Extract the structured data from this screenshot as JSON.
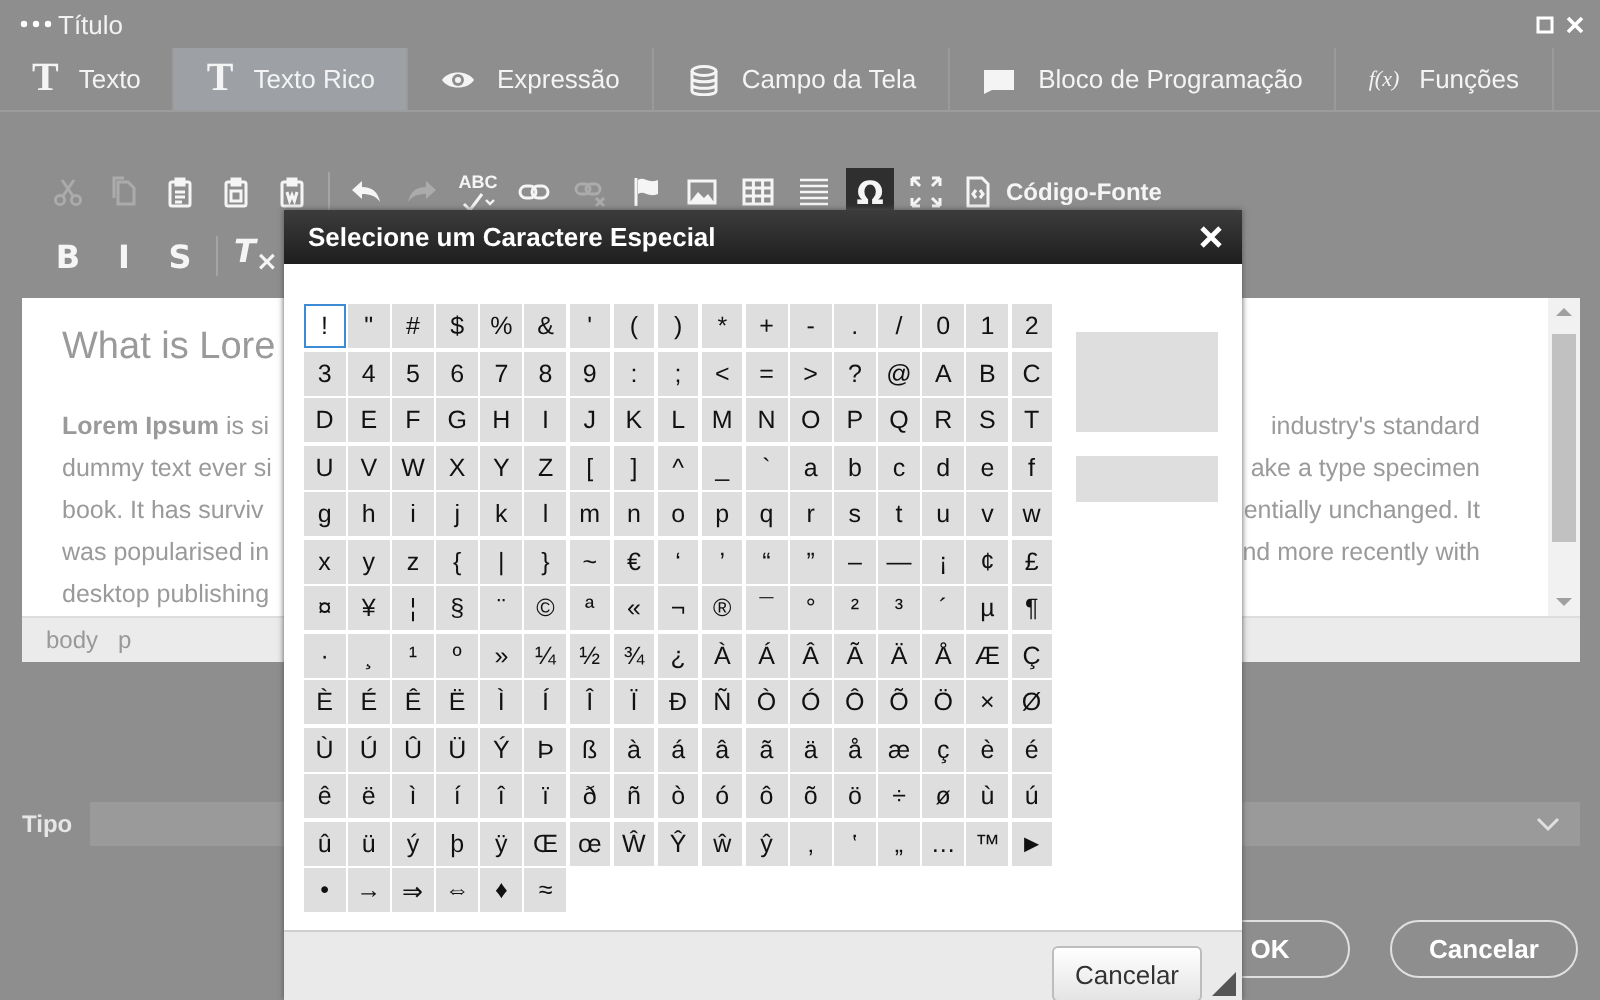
{
  "window": {
    "title": "Título"
  },
  "tabs": [
    {
      "label": "Texto",
      "glyph": "T",
      "selected": false
    },
    {
      "label": "Texto Rico",
      "glyph": "T",
      "selected": true
    },
    {
      "label": "Expressão",
      "selected": false
    },
    {
      "label": "Campo da Tela",
      "selected": false
    },
    {
      "label": "Bloco de Programação",
      "selected": false
    },
    {
      "label": "Funções",
      "glyph": "f(x)",
      "selected": false
    }
  ],
  "toolbar": {
    "row_1": [
      {
        "kind": "icon",
        "disabled": true,
        "active": false
      },
      {
        "kind": "icon",
        "disabled": true,
        "active": false
      },
      {
        "kind": "icon",
        "disabled": false,
        "active": false
      },
      {
        "kind": "icon",
        "disabled": false,
        "active": false
      },
      {
        "kind": "icon",
        "disabled": false,
        "active": false
      },
      {
        "kind": "separator"
      },
      {
        "kind": "icon",
        "disabled": false,
        "active": false
      },
      {
        "kind": "icon",
        "disabled": true,
        "active": false
      },
      {
        "kind": "labeled",
        "label": "ABC",
        "disabled": false,
        "active": false
      },
      {
        "kind": "icon",
        "disabled": false,
        "active": false
      },
      {
        "kind": "icon",
        "disabled": true,
        "active": false
      },
      {
        "kind": "icon",
        "disabled": false,
        "active": false
      },
      {
        "kind": "icon",
        "disabled": false,
        "active": false
      },
      {
        "kind": "icon",
        "disabled": false,
        "active": false
      },
      {
        "kind": "icon",
        "disabled": false,
        "active": false
      },
      {
        "kind": "glyph",
        "label": "Ω",
        "disabled": false,
        "active": true
      },
      {
        "kind": "icon",
        "disabled": false,
        "active": false
      },
      {
        "kind": "labeled",
        "label": "Código-Fonte",
        "disabled": false,
        "active": false
      }
    ],
    "row_2": [
      {
        "kind": "glyph",
        "label": "B",
        "disabled": false,
        "active": false
      },
      {
        "kind": "glyph",
        "label": "I",
        "disabled": false,
        "active": false
      },
      {
        "kind": "glyph",
        "label": "S",
        "disabled": false,
        "active": false
      },
      {
        "kind": "separator"
      },
      {
        "kind": "glyph",
        "label": "*T*$_{×}$",
        "disabled": false,
        "active": false
      }
    ]
  },
  "editor": {
    "heading": "What is Lore",
    "left_lines": [
      "**Lorem Ipsum** is si",
      "dummy text ever si",
      "book. It has surviv",
      "was popularised in",
      "desktop publishing"
    ],
    "right_lines": [
      "industry's standard",
      "ake a type specimen",
      "entially unchanged. It",
      "nd more recently with"
    ],
    "path": [
      "body",
      "p"
    ]
  },
  "tipo": {
    "label": "Tipo"
  },
  "buttons": [
    "OK",
    "Cancelar"
  ],
  "dialog": {
    "title": "Selecione um Caractere Especial",
    "cancel": "Cancelar",
    "characters": [
      {
        "char": "!",
        "selected": true
      },
      {
        "char": "\"",
        "selected": false
      },
      {
        "char": "#",
        "selected": false
      },
      {
        "char": "$",
        "selected": false
      },
      {
        "char": "%",
        "selected": false
      },
      {
        "char": "&",
        "selected": false
      },
      {
        "char": "'",
        "selected": false
      },
      {
        "char": "(",
        "selected": false
      },
      {
        "char": ")",
        "selected": false
      },
      {
        "char": "*",
        "selected": false
      },
      {
        "char": "+",
        "selected": false
      },
      {
        "char": "-",
        "selected": false
      },
      {
        "char": ".",
        "selected": false
      },
      {
        "char": "/",
        "selected": false
      },
      {
        "char": "0",
        "selected": false
      },
      {
        "char": "1",
        "selected": false
      },
      {
        "char": "2",
        "selected": false
      },
      {
        "char": "3",
        "selected": false
      },
      {
        "char": "4",
        "selected": false
      },
      {
        "char": "5",
        "selected": false
      },
      {
        "char": "6",
        "selected": false
      },
      {
        "char": "7",
        "selected": false
      },
      {
        "char": "8",
        "selected": false
      },
      {
        "char": "9",
        "selected": false
      },
      {
        "char": ":",
        "selected": false
      },
      {
        "char": ";",
        "selected": false
      },
      {
        "char": "<",
        "selected": false
      },
      {
        "char": "=",
        "selected": false
      },
      {
        "char": ">",
        "selected": false
      },
      {
        "char": "?",
        "selected": false
      },
      {
        "char": "@",
        "selected": false
      },
      {
        "char": "A",
        "selected": false
      },
      {
        "char": "B",
        "selected": false
      },
      {
        "char": "C",
        "selected": false
      },
      {
        "char": "D",
        "selected": false
      },
      {
        "char": "E",
        "selected": false
      },
      {
        "char": "F",
        "selected": false
      },
      {
        "char": "G",
        "selected": false
      },
      {
        "char": "H",
        "selected": false
      },
      {
        "char": "I",
        "selected": false
      },
      {
        "char": "J",
        "selected": false
      },
      {
        "char": "K",
        "selected": false
      },
      {
        "char": "L",
        "selected": false
      },
      {
        "char": "M",
        "selected": false
      },
      {
        "char": "N",
        "selected": false
      },
      {
        "char": "O",
        "selected": false
      },
      {
        "char": "P",
        "selected": false
      },
      {
        "char": "Q",
        "selected": false
      },
      {
        "char": "R",
        "selected": false
      },
      {
        "char": "S",
        "selected": false
      },
      {
        "char": "T",
        "selected": false
      },
      {
        "char": "U",
        "selected": false
      },
      {
        "char": "V",
        "selected": false
      },
      {
        "char": "W",
        "selected": false
      },
      {
        "char": "X",
        "selected": false
      },
      {
        "char": "Y",
        "selected": false
      },
      {
        "char": "Z",
        "selected": false
      },
      {
        "char": "[",
        "selected": false
      },
      {
        "char": "]",
        "selected": false
      },
      {
        "char": "^",
        "selected": false
      },
      {
        "char": "_",
        "selected": false
      },
      {
        "char": "`",
        "selected": false
      },
      {
        "char": "a",
        "selected": false
      },
      {
        "char": "b",
        "selected": false
      },
      {
        "char": "c",
        "selected": false
      },
      {
        "char": "d",
        "selected": false
      },
      {
        "char": "e",
        "selected": false
      },
      {
        "char": "f",
        "selected": false
      },
      {
        "char": "g",
        "selected": false
      },
      {
        "char": "h",
        "selected": false
      },
      {
        "char": "i",
        "selected": false
      },
      {
        "char": "j",
        "selected": false
      },
      {
        "char": "k",
        "selected": false
      },
      {
        "char": "l",
        "selected": false
      },
      {
        "char": "m",
        "selected": false
      },
      {
        "char": "n",
        "selected": false
      },
      {
        "char": "o",
        "selected": false
      },
      {
        "char": "p",
        "selected": false
      },
      {
        "char": "q",
        "selected": false
      },
      {
        "char": "r",
        "selected": false
      },
      {
        "char": "s",
        "selected": false
      },
      {
        "char": "t",
        "selected": false
      },
      {
        "char": "u",
        "selected": false
      },
      {
        "char": "v",
        "selected": false
      },
      {
        "char": "w",
        "selected": false
      },
      {
        "char": "x",
        "selected": false
      },
      {
        "char": "y",
        "selected": false
      },
      {
        "char": "z",
        "selected": false
      },
      {
        "char": "{",
        "selected": false
      },
      {
        "char": "|",
        "selected": false
      },
      {
        "char": "}",
        "selected": false
      },
      {
        "char": "~",
        "selected": false
      },
      {
        "char": "€",
        "selected": false
      },
      {
        "char": "‘",
        "selected": false
      },
      {
        "char": "’",
        "selected": false
      },
      {
        "char": "“",
        "selected": false
      },
      {
        "char": "”",
        "selected": false
      },
      {
        "char": "–",
        "selected": false
      },
      {
        "char": "—",
        "selected": false
      },
      {
        "char": "¡",
        "selected": false
      },
      {
        "char": "¢",
        "selected": false
      },
      {
        "char": "£",
        "selected": false
      },
      {
        "char": "¤",
        "selected": false
      },
      {
        "char": "¥",
        "selected": false
      },
      {
        "char": "¦",
        "selected": false
      },
      {
        "char": "§",
        "selected": false
      },
      {
        "char": "¨",
        "selected": false
      },
      {
        "char": "©",
        "selected": false
      },
      {
        "char": "ª",
        "selected": false
      },
      {
        "char": "«",
        "selected": false
      },
      {
        "char": "¬",
        "selected": false
      },
      {
        "char": "®",
        "selected": false
      },
      {
        "char": "¯",
        "selected": false
      },
      {
        "char": "°",
        "selected": false
      },
      {
        "char": "²",
        "selected": false
      },
      {
        "char": "³",
        "selected": false
      },
      {
        "char": "´",
        "selected": false
      },
      {
        "char": "µ",
        "selected": false
      },
      {
        "char": "¶",
        "selected": false
      },
      {
        "char": "·",
        "selected": false
      },
      {
        "char": "¸",
        "selected": false
      },
      {
        "char": "¹",
        "selected": false
      },
      {
        "char": "º",
        "selected": false
      },
      {
        "char": "»",
        "selected": false
      },
      {
        "char": "¼",
        "selected": false
      },
      {
        "char": "½",
        "selected": false
      },
      {
        "char": "¾",
        "selected": false
      },
      {
        "char": "¿",
        "selected": false
      },
      {
        "char": "À",
        "selected": false
      },
      {
        "char": "Á",
        "selected": false
      },
      {
        "char": "Â",
        "selected": false
      },
      {
        "char": "Ã",
        "selected": false
      },
      {
        "char": "Ä",
        "selected": false
      },
      {
        "char": "Å",
        "selected": false
      },
      {
        "char": "Æ",
        "selected": false
      },
      {
        "char": "Ç",
        "selected": false
      },
      {
        "char": "È",
        "selected": false
      },
      {
        "char": "É",
        "selected": false
      },
      {
        "char": "Ê",
        "selected": false
      },
      {
        "char": "Ë",
        "selected": false
      },
      {
        "char": "Ì",
        "selected": false
      },
      {
        "char": "Í",
        "selected": false
      },
      {
        "char": "Î",
        "selected": false
      },
      {
        "char": "Ï",
        "selected": false
      },
      {
        "char": "Ð",
        "selected": false
      },
      {
        "char": "Ñ",
        "selected": false
      },
      {
        "char": "Ò",
        "selected": false
      },
      {
        "char": "Ó",
        "selected": false
      },
      {
        "char": "Ô",
        "selected": false
      },
      {
        "char": "Õ",
        "selected": false
      },
      {
        "char": "Ö",
        "selected": false
      },
      {
        "char": "×",
        "selected": false
      },
      {
        "char": "Ø",
        "selected": false
      },
      {
        "char": "Ù",
        "selected": false
      },
      {
        "char": "Ú",
        "selected": false
      },
      {
        "char": "Û",
        "selected": false
      },
      {
        "char": "Ü",
        "selected": false
      },
      {
        "char": "Ý",
        "selected": false
      },
      {
        "char": "Þ",
        "selected": false
      },
      {
        "char": "ß",
        "selected": false
      },
      {
        "char": "à",
        "selected": false
      },
      {
        "char": "á",
        "selected": false
      },
      {
        "char": "â",
        "selected": false
      },
      {
        "char": "ã",
        "selected": false
      },
      {
        "char": "ä",
        "selected": false
      },
      {
        "char": "å",
        "selected": false
      },
      {
        "char": "æ",
        "selected": false
      },
      {
        "char": "ç",
        "selected": false
      },
      {
        "char": "è",
        "selected": false
      },
      {
        "char": "é",
        "selected": false
      },
      {
        "char": "ê",
        "selected": false
      },
      {
        "char": "ë",
        "selected": false
      },
      {
        "char": "ì",
        "selected": false
      },
      {
        "char": "í",
        "selected": false
      },
      {
        "char": "î",
        "selected": false
      },
      {
        "char": "ï",
        "selected": false
      },
      {
        "char": "ð",
        "selected": false
      },
      {
        "char": "ñ",
        "selected": false
      },
      {
        "char": "ò",
        "selected": false
      },
      {
        "char": "ó",
        "selected": false
      },
      {
        "char": "ô",
        "selected": false
      },
      {
        "char": "õ",
        "selected": false
      },
      {
        "char": "ö",
        "selected": false
      },
      {
        "char": "÷",
        "selected": false
      },
      {
        "char": "ø",
        "selected": false
      },
      {
        "char": "ù",
        "selected": false
      },
      {
        "char": "ú",
        "selected": false
      },
      {
        "char": "û",
        "selected": false
      },
      {
        "char": "ü",
        "selected": false
      },
      {
        "char": "ý",
        "selected": false
      },
      {
        "char": "þ",
        "selected": false
      },
      {
        "char": "ÿ",
        "selected": false
      },
      {
        "char": "Œ",
        "selected": false
      },
      {
        "char": "œ",
        "selected": false
      },
      {
        "char": "Ŵ",
        "selected": false
      },
      {
        "char": "Ŷ",
        "selected": false
      },
      {
        "char": "ŵ",
        "selected": false
      },
      {
        "char": "ŷ",
        "selected": false
      },
      {
        "char": "‚",
        "selected": false
      },
      {
        "char": "‛",
        "selected": false
      },
      {
        "char": "„",
        "selected": false
      },
      {
        "char": "…",
        "selected": false
      },
      {
        "char": "™",
        "selected": false
      },
      {
        "char": "►",
        "selected": false
      },
      {
        "char": "•",
        "selected": false
      },
      {
        "char": "→",
        "selected": false
      },
      {
        "char": "⇒",
        "selected": false
      },
      {
        "char": "⇔",
        "selected": false
      },
      {
        "char": "♦",
        "selected": false
      },
      {
        "char": "≈",
        "selected": false
      }
    ]
  }
}
